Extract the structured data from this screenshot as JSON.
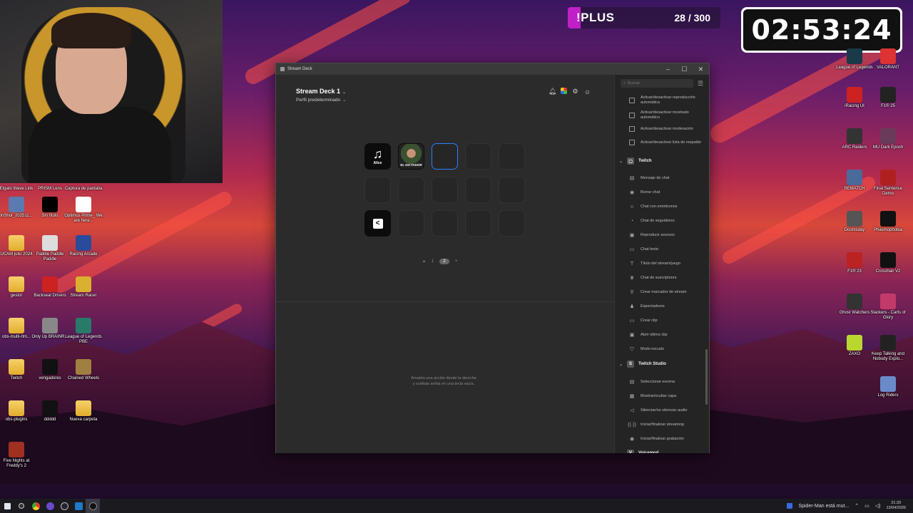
{
  "overlay": {
    "plus_label": "!PLUS",
    "plus_count": "28 / 300",
    "timer": "02:53:24"
  },
  "desktop_icons_left": [
    {
      "label": "Elgato Wave Link",
      "kind": "app",
      "color": "#222"
    },
    {
      "label": "PRISM Lens",
      "kind": "app",
      "color": "#1a1a1a"
    },
    {
      "label": "Captura de pantalla ...",
      "kind": "app",
      "color": "#d23"
    },
    {
      "label": "InShot_202511...",
      "kind": "app",
      "color": "#5a7ab0"
    },
    {
      "label": "Sin título",
      "kind": "app",
      "color": "#000"
    },
    {
      "label": "Optimus Prime_ We are here...",
      "kind": "app",
      "color": "#fff"
    },
    {
      "label": "UCAM julio 2024",
      "kind": "folder",
      "color": "#e8b94a"
    },
    {
      "label": "Paddle Paddle Paddle",
      "kind": "app",
      "color": "#ddd"
    },
    {
      "label": "Racing Arcade",
      "kind": "app",
      "color": "#2a4a9a"
    },
    {
      "label": "gestor",
      "kind": "folder",
      "color": "#e8b94a"
    },
    {
      "label": "Backseat Drivers",
      "kind": "app",
      "color": "#c22"
    },
    {
      "label": "Stream Racer",
      "kind": "app",
      "color": "#d9b030"
    },
    {
      "label": "obs-multi-rtm...",
      "kind": "folder",
      "color": "#e8b94a"
    },
    {
      "label": "Only Up BRAINR...",
      "kind": "app",
      "color": "#888"
    },
    {
      "label": "League of Legends PBE",
      "kind": "app",
      "color": "#2a7a6a"
    },
    {
      "label": "Twitch",
      "kind": "folder",
      "color": "#e8b94a"
    },
    {
      "label": "vengadores",
      "kind": "app",
      "color": "#111"
    },
    {
      "label": "Chained Wheels",
      "kind": "app",
      "color": "#a08040"
    },
    {
      "label": "obs-plugins",
      "kind": "folder",
      "color": "#e8b94a"
    },
    {
      "label": "ddddd",
      "kind": "app",
      "color": "#111"
    },
    {
      "label": "Nueva carpeta",
      "kind": "folder",
      "color": "#e8b94a"
    },
    {
      "label": "Five Nights at Freddy's 2",
      "kind": "app",
      "color": "#a03020"
    }
  ],
  "desktop_icons_right": [
    {
      "label": "League of Legends",
      "color": "#1a3a4a"
    },
    {
      "label": "VALORANT",
      "color": "#d33"
    },
    {
      "label": "iRacing UI",
      "color": "#c22"
    },
    {
      "label": "F1® 25",
      "color": "#222"
    },
    {
      "label": "ARC Raiders",
      "color": "#333"
    },
    {
      "label": "MU Dark Epoch",
      "color": "#6a3a5a"
    },
    {
      "label": "REMATCH",
      "color": "#4a6a9a"
    },
    {
      "label": "Final Sentence Demo",
      "color": "#b02020"
    },
    {
      "label": "Doomsday",
      "color": "#555"
    },
    {
      "label": "Phasmophobia",
      "color": "#111"
    },
    {
      "label": "F1® 23",
      "color": "#b22"
    },
    {
      "label": "Crosshair V2",
      "color": "#111"
    },
    {
      "label": "Ghost Watchers",
      "color": "#333"
    },
    {
      "label": "Slackers - Carts of Glory",
      "color": "#c23a6a"
    },
    {
      "label": "ZAXO",
      "color": "#b8d830"
    },
    {
      "label": "Keep Talking and Nobody Explo...",
      "color": "#222"
    },
    {
      "label": "Log Riders",
      "color": "#6a8aca"
    }
  ],
  "window": {
    "title": "Stream Deck",
    "device": "Stream Deck 1",
    "profile": "Perfil predeterminado",
    "keys": [
      {
        "title": "Alice",
        "type": "music",
        "glyph": "♫"
      },
      {
        "title": "EL DICTADOR",
        "type": "photo"
      },
      {
        "title": "",
        "type": "selected"
      },
      {
        "title": "",
        "type": "empty"
      },
      {
        "title": "",
        "type": "empty"
      },
      {
        "title": "",
        "type": "empty"
      },
      {
        "title": "",
        "type": "empty"
      },
      {
        "title": "",
        "type": "empty"
      },
      {
        "title": "",
        "type": "empty"
      },
      {
        "title": "",
        "type": "empty"
      },
      {
        "title": "",
        "type": "back",
        "glyph": "<"
      },
      {
        "title": "",
        "type": "empty"
      },
      {
        "title": "",
        "type": "empty"
      },
      {
        "title": "",
        "type": "empty"
      },
      {
        "title": "",
        "type": "empty"
      }
    ],
    "pages": [
      "1",
      "2"
    ],
    "active_page": "2",
    "drop_hint_line1": "Arrastra una acción desde la derecha",
    "drop_hint_line2": "y suéltala arriba en una tecla vacía.",
    "search_placeholder": "Buscar"
  },
  "sidebar": {
    "top_actions": [
      "Activar/desactivar reproducción automática",
      "Activar/desactivar mostrado automático",
      "Activar/desactivar moderación",
      "Activar/desactivar lista de respaldo"
    ],
    "twitch_label": "Twitch",
    "twitch_actions": [
      "Mensaje de chat",
      "Borrar chat",
      "Chat con emoticonos",
      "Chat de seguidores",
      "Reproducir anuncio",
      "Chat lento",
      "Título del stream/juego",
      "Chat de suscriptores",
      "Crear marcador de stream",
      "Espectadores",
      "Crear clip",
      "Abrir último clip",
      "Modo escudo"
    ],
    "studio_label": "Twitch Studio",
    "studio_actions": [
      "Seleccionar escena",
      "Mostrar/ocultar capa",
      "Silenciar/no silenciar audio",
      "Iniciar/finalizar streaming",
      "Iniciar/finalizar grabación"
    ],
    "voicemod_label": "Voicemod"
  },
  "taskbar": {
    "notification": "Spider-Man está mut...",
    "time": "21:33",
    "date": "13/04/2026"
  }
}
